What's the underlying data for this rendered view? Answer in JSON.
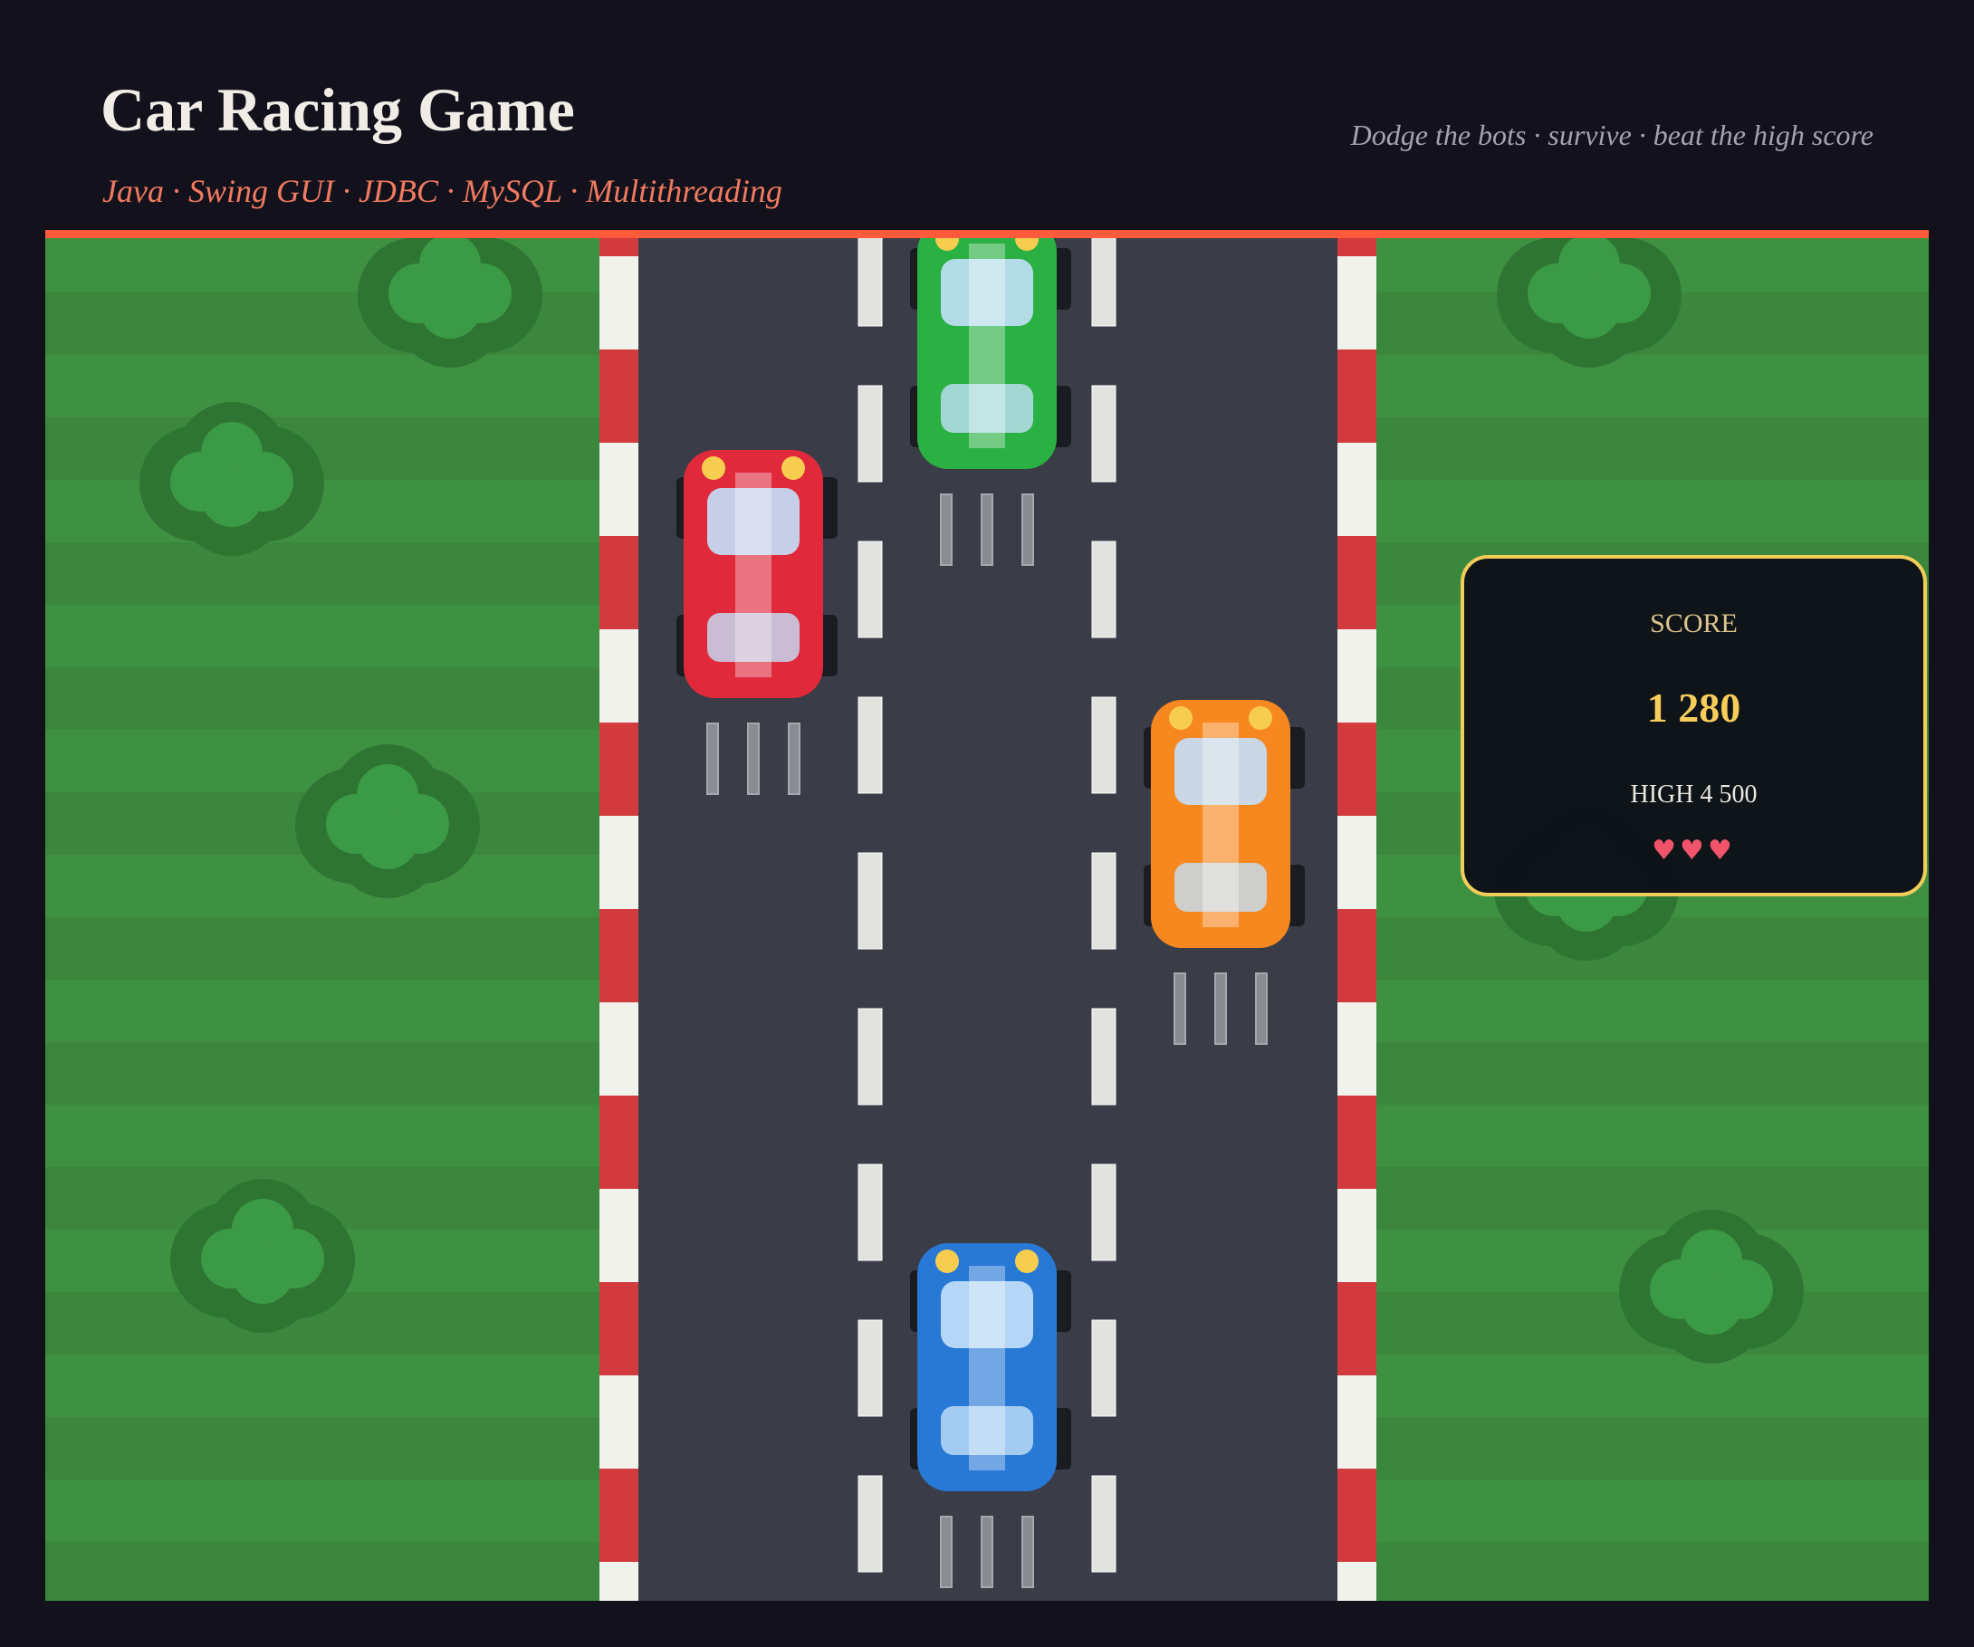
{
  "header": {
    "title": "Car Racing Game",
    "subtitle": "Java · Swing GUI · JDBC · MySQL · Multithreading",
    "tagline": "Dodge the bots · survive · beat the high score"
  },
  "hud": {
    "score_label": "SCORE",
    "score_value": "1 280",
    "high": "HIGH  4 500",
    "lives": "♥♥♥",
    "lives_count": 3
  },
  "cars": [
    {
      "role": "bot",
      "color": "red",
      "body": "#e02a3c",
      "lane": 1
    },
    {
      "role": "bot",
      "color": "green",
      "body": "#2ab043",
      "lane": 2
    },
    {
      "role": "bot",
      "color": "orange",
      "body": "#f7881f",
      "lane": 3
    },
    {
      "role": "player",
      "color": "blue",
      "body": "#2878d6",
      "lane": 2
    }
  ],
  "colors": {
    "accent": "#ff5a3c",
    "grass": "#3d8e40",
    "road": "#3a3d47",
    "curb_red": "#d23b3e",
    "curb_white": "#f2f2ed",
    "hud_border": "#f3cd59"
  }
}
